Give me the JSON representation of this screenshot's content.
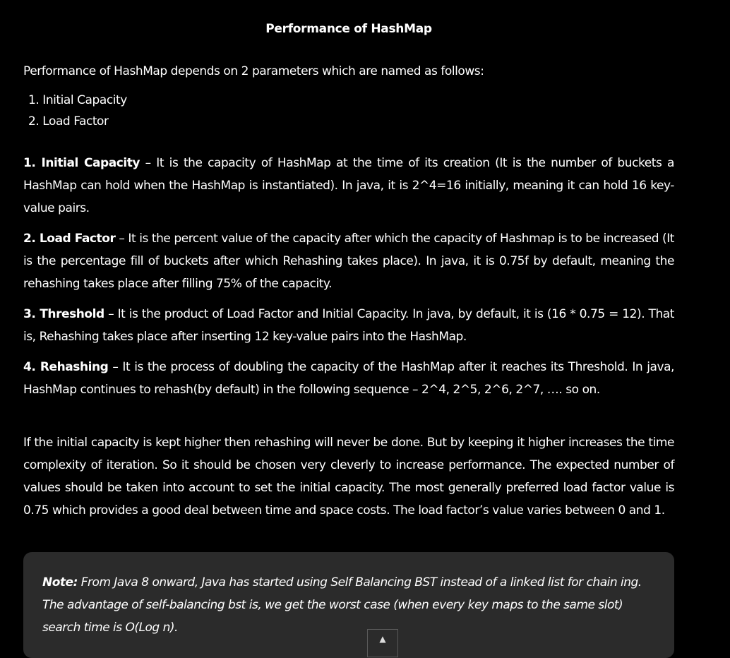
{
  "title": "Performance of HashMap",
  "intro": "Performance of HashMap depends on 2 parameters which are named as follows:",
  "parameters": [
    "1. Initial Capacity",
    "2. Load Factor"
  ],
  "definitions": [
    {
      "term": "1. Initial Capacity",
      "text": " – It is the capacity of HashMap at the time of its creation (It is the number of buckets a HashMap can hold when the HashMap is instantiated). In java, it is 2^4=16 initially, meaning it can hold 16 key-value pairs."
    },
    {
      "term": "2. Load Factor",
      "text": " – It is the percent value of the capacity after which the capacity of Hashmap is to be increased (It is the percentage fill of buckets after which Rehashing takes place). In java, it is 0.75f by default, meaning the rehashing takes place after filling 75% of the capacity."
    },
    {
      "term": "3. Threshold",
      "text": " – It is the product of Load Factor and Initial Capacity. In java, by default, it is (16 * 0.75 = 12). That is, Rehashing takes place after inserting 12 key-value pairs into the HashMap."
    },
    {
      "term": "4. Rehashing",
      "text": " – It is the process of doubling the capacity of the HashMap after it reaches its Threshold. In java, HashMap continues to rehash(by default) in the following sequence – 2^4, 2^5, 2^6, 2^7, …. so on."
    }
  ],
  "summary": "If the initial capacity is kept higher then rehashing will never be done. But by keeping it higher increases the time complexity of iteration. So it should be chosen very cleverly to increase performance. The expected number of values should be taken into account to set the initial capacity. The most generally preferred load factor value is 0.75 which provides a good deal between time and space costs. The load factor’s value varies between 0 and 1.",
  "note": {
    "label": "Note:",
    "text": " From Java 8 onward, Java has started using Self Balancing BST instead of a linked list for chain ing. The advantage of self-balancing bst is, we get the worst case (when every key maps to the same slot) search time is O(Log n)."
  },
  "scroll_top_icon": "chevron-up-icon",
  "colors": {
    "background": "#000000",
    "text": "#ffffff",
    "note_background": "#2b2b2b"
  }
}
